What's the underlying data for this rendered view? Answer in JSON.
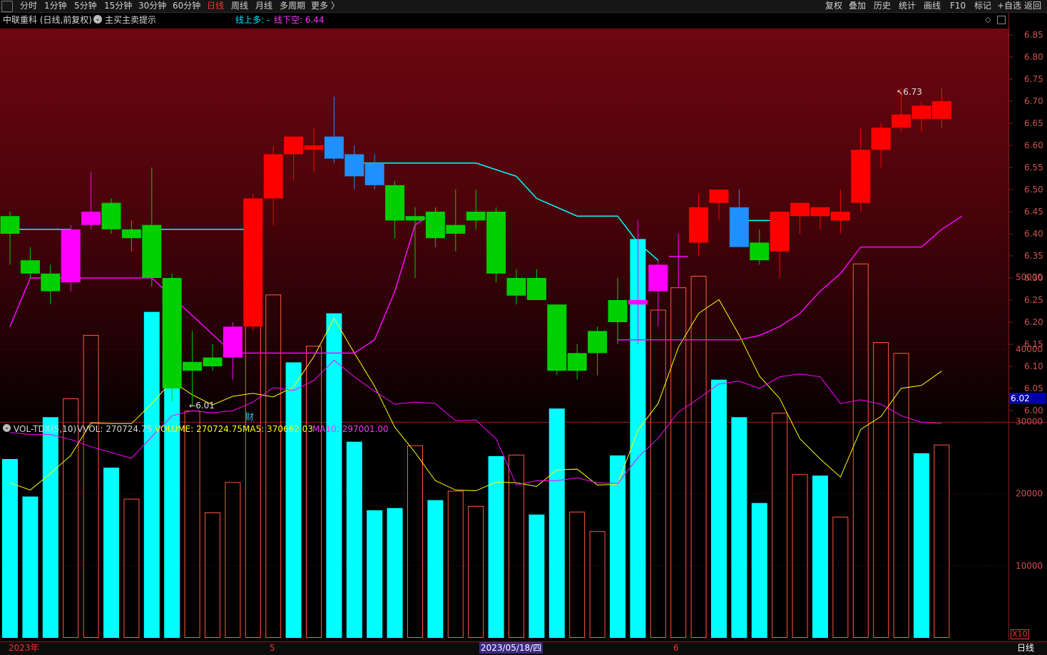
{
  "toolbar": {
    "periods": [
      "分时",
      "1分钟",
      "5分钟",
      "15分钟",
      "30分钟",
      "60分钟",
      "日线",
      "周线",
      "月线",
      "多周期",
      "更多 〉"
    ],
    "active_period": "日线",
    "right_items": [
      "复权",
      "叠加",
      "历史",
      "统计",
      "画线",
      "F10",
      "标记",
      "+自选",
      "返回"
    ]
  },
  "header": {
    "stock_label": "中联重科 (日线,前复权)",
    "indicator_label": "主买主卖提示",
    "line_up_label": "线上多: -",
    "line_down_label": "线下空: 6.44"
  },
  "volume_header": {
    "name": "VOL-TDX(5,10)",
    "vvol": "VVOL: 270724.75",
    "volume": "VOLUME: 270724.75",
    "ma5": "MA5: 370662.03",
    "ma10": "MA10: 297001.00"
  },
  "annotations": {
    "high_label": "6.73",
    "low_label": "6.01",
    "finance_marker": "财",
    "current_price_tag": "6.02"
  },
  "x_axis": {
    "start_label": "2023年",
    "month_may": "5",
    "cursor_date": "2023/05/18/四",
    "month_jun": "6"
  },
  "footer": {
    "period_label": "日线",
    "volume_multiplier": "X10"
  },
  "colors": {
    "background_top": "#6e0610",
    "background_bottom": "#060001",
    "up": "#ff0000",
    "down": "#00d000",
    "magenta": "#ff00ff",
    "cyan": "#00ffff",
    "blue": "#1e90ff",
    "yellow": "#ffff00"
  },
  "chart_data": [
    {
      "type": "candlestick",
      "title": "中联重科 (日线,前复权)",
      "ylim": [
        6.0,
        6.86
      ],
      "y_ticks": [
        "6.85",
        "6.80",
        "6.75",
        "6.70",
        "6.65",
        "6.60",
        "6.55",
        "6.50",
        "6.45",
        "6.40",
        "6.35",
        "6.30",
        "6.25",
        "6.20",
        "6.15",
        "6.10",
        "6.05",
        "6.00"
      ],
      "candles": [
        {
          "o": 6.4,
          "h": 6.45,
          "l": 6.33,
          "c": 6.44,
          "col": "down"
        },
        {
          "o": 6.34,
          "h": 6.37,
          "l": 6.3,
          "c": 6.31,
          "col": "down"
        },
        {
          "o": 6.31,
          "h": 6.33,
          "l": 6.24,
          "c": 6.27,
          "col": "down"
        },
        {
          "o": 6.29,
          "h": 6.42,
          "l": 6.27,
          "c": 6.41,
          "col": "magenta"
        },
        {
          "o": 6.42,
          "h": 6.54,
          "l": 6.41,
          "c": 6.45,
          "col": "magenta"
        },
        {
          "o": 6.47,
          "h": 6.48,
          "l": 6.4,
          "c": 6.41,
          "col": "down"
        },
        {
          "o": 6.41,
          "h": 6.43,
          "l": 6.36,
          "c": 6.39,
          "col": "down"
        },
        {
          "o": 6.42,
          "h": 6.55,
          "l": 6.28,
          "c": 6.3,
          "col": "down"
        },
        {
          "o": 6.3,
          "h": 6.31,
          "l": 6.02,
          "c": 6.05,
          "col": "down"
        },
        {
          "o": 6.11,
          "h": 6.18,
          "l": 6.01,
          "c": 6.09,
          "col": "down"
        },
        {
          "o": 6.12,
          "h": 6.15,
          "l": 6.09,
          "c": 6.1,
          "col": "down"
        },
        {
          "o": 6.12,
          "h": 6.2,
          "l": 6.07,
          "c": 6.19,
          "col": "magenta"
        },
        {
          "o": 6.19,
          "h": 6.49,
          "l": 6.18,
          "c": 6.48,
          "col": "up"
        },
        {
          "o": 6.48,
          "h": 6.6,
          "l": 6.42,
          "c": 6.58,
          "col": "up"
        },
        {
          "o": 6.58,
          "h": 6.62,
          "l": 6.52,
          "c": 6.62,
          "col": "up"
        },
        {
          "o": 6.6,
          "h": 6.64,
          "l": 6.54,
          "c": 6.59,
          "col": "up"
        },
        {
          "o": 6.62,
          "h": 6.71,
          "l": 6.56,
          "c": 6.57,
          "col": "blue"
        },
        {
          "o": 6.58,
          "h": 6.6,
          "l": 6.5,
          "c": 6.53,
          "col": "blue"
        },
        {
          "o": 6.56,
          "h": 6.58,
          "l": 6.5,
          "c": 6.51,
          "col": "blue"
        },
        {
          "o": 6.51,
          "h": 6.52,
          "l": 6.39,
          "c": 6.43,
          "col": "down"
        },
        {
          "o": 6.43,
          "h": 6.46,
          "l": 6.3,
          "c": 6.44,
          "col": "down"
        },
        {
          "o": 6.45,
          "h": 6.46,
          "l": 6.37,
          "c": 6.39,
          "col": "down"
        },
        {
          "o": 6.42,
          "h": 6.5,
          "l": 6.36,
          "c": 6.4,
          "col": "down"
        },
        {
          "o": 6.45,
          "h": 6.5,
          "l": 6.41,
          "c": 6.43,
          "col": "down"
        },
        {
          "o": 6.45,
          "h": 6.46,
          "l": 6.29,
          "c": 6.31,
          "col": "down"
        },
        {
          "o": 6.3,
          "h": 6.32,
          "l": 6.24,
          "c": 6.26,
          "col": "down"
        },
        {
          "o": 6.3,
          "h": 6.32,
          "l": 6.25,
          "c": 6.25,
          "col": "down"
        },
        {
          "o": 6.24,
          "h": 6.24,
          "l": 6.08,
          "c": 6.09,
          "col": "down"
        },
        {
          "o": 6.13,
          "h": 6.15,
          "l": 6.07,
          "c": 6.09,
          "col": "down"
        },
        {
          "o": 6.18,
          "h": 6.19,
          "l": 6.08,
          "c": 6.13,
          "col": "down"
        },
        {
          "o": 6.25,
          "h": 6.3,
          "l": 6.15,
          "c": 6.2,
          "col": "down"
        },
        {
          "o": 6.25,
          "h": 6.43,
          "l": 6.15,
          "c": 6.24,
          "col": "magenta"
        },
        {
          "o": 6.27,
          "h": 6.34,
          "l": 6.19,
          "c": 6.33,
          "col": "magenta"
        },
        {
          "o": 6.35,
          "h": 6.4,
          "l": 6.28,
          "c": 6.35,
          "col": "magenta"
        },
        {
          "o": 6.38,
          "h": 6.49,
          "l": 6.35,
          "c": 6.46,
          "col": "up"
        },
        {
          "o": 6.47,
          "h": 6.5,
          "l": 6.43,
          "c": 6.5,
          "col": "up"
        },
        {
          "o": 6.46,
          "h": 6.5,
          "l": 6.37,
          "c": 6.37,
          "col": "blue"
        },
        {
          "o": 6.38,
          "h": 6.41,
          "l": 6.33,
          "c": 6.34,
          "col": "down"
        },
        {
          "o": 6.36,
          "h": 6.45,
          "l": 6.3,
          "c": 6.45,
          "col": "up"
        },
        {
          "o": 6.44,
          "h": 6.47,
          "l": 6.4,
          "c": 6.47,
          "col": "up"
        },
        {
          "o": 6.44,
          "h": 6.46,
          "l": 6.41,
          "c": 6.46,
          "col": "up"
        },
        {
          "o": 6.43,
          "h": 6.5,
          "l": 6.4,
          "c": 6.45,
          "col": "up"
        },
        {
          "o": 6.47,
          "h": 6.64,
          "l": 6.45,
          "c": 6.59,
          "col": "up"
        },
        {
          "o": 6.59,
          "h": 6.65,
          "l": 6.55,
          "c": 6.64,
          "col": "up"
        },
        {
          "o": 6.64,
          "h": 6.73,
          "l": 6.63,
          "c": 6.67,
          "col": "up"
        },
        {
          "o": 6.66,
          "h": 6.7,
          "l": 6.63,
          "c": 6.69,
          "col": "up"
        },
        {
          "o": 6.66,
          "h": 6.73,
          "l": 6.64,
          "c": 6.7,
          "col": "up"
        }
      ],
      "support_line": [
        [
          0,
          6.19
        ],
        [
          1,
          6.3
        ],
        [
          2,
          6.3
        ],
        [
          3,
          6.3
        ],
        [
          4,
          6.3
        ],
        [
          5,
          6.3
        ],
        [
          6,
          6.3
        ],
        [
          7,
          6.3
        ],
        [
          11,
          6.13
        ],
        [
          17,
          6.13
        ],
        [
          18,
          6.16
        ],
        [
          19,
          6.27
        ],
        [
          20,
          6.42
        ],
        [
          21,
          6.45
        ],
        {
          "break": true
        },
        [
          30,
          6.16
        ],
        [
          35,
          6.16
        ],
        [
          36,
          6.16
        ],
        [
          37,
          6.17
        ],
        [
          38,
          6.19
        ],
        [
          39,
          6.22
        ],
        [
          40,
          6.27
        ],
        [
          41,
          6.31
        ],
        [
          42,
          6.37
        ],
        [
          45,
          6.37
        ],
        [
          46,
          6.41
        ],
        [
          47,
          6.44
        ]
      ],
      "resistance_line": [
        [
          0,
          6.41
        ],
        [
          3,
          6.41
        ],
        {
          "break": true
        },
        [
          7,
          6.41
        ],
        [
          12,
          6.41
        ],
        {
          "break": true
        },
        [
          17,
          6.56
        ],
        [
          23,
          6.56
        ],
        [
          25,
          6.53
        ],
        [
          26,
          6.48
        ],
        [
          28,
          6.44
        ],
        [
          30,
          6.44
        ],
        [
          31,
          6.38
        ],
        [
          32,
          6.34
        ],
        {
          "break": true
        },
        [
          36,
          6.43
        ],
        [
          38,
          6.43
        ]
      ]
    },
    {
      "type": "bar",
      "title": "VOL-TDX(5,10)",
      "ylim": [
        0,
        60000
      ],
      "y_ticks": [
        "50000",
        "40000",
        "30000",
        "20000",
        "10000"
      ],
      "values": [
        24800,
        19600,
        30600,
        33200,
        42000,
        23600,
        19300,
        45200,
        49600,
        31500,
        17400,
        21600,
        49200,
        47600,
        38200,
        40500,
        45000,
        27200,
        17700,
        18000,
        26700,
        19100,
        20400,
        18300,
        25200,
        25400,
        17100,
        31800,
        17500,
        14800,
        25300,
        55300,
        45500,
        48600,
        50200,
        35800,
        30600,
        18700,
        31200,
        22700,
        22500,
        16800,
        51900,
        41000,
        39500,
        25600,
        26800
      ],
      "bar_style": [
        "solid",
        "solid",
        "solid",
        "hollow",
        "hollow",
        "solid",
        "hollow",
        "solid",
        "solid",
        "hollow",
        "hollow",
        "hollow",
        "hollow",
        "hollow",
        "solid",
        "hollow",
        "solid",
        "solid",
        "solid",
        "solid",
        "hollow",
        "solid",
        "hollow",
        "hollow",
        "solid",
        "hollow",
        "solid",
        "solid",
        "hollow",
        "hollow",
        "solid",
        "solid",
        "hollow",
        "hollow",
        "hollow",
        "solid",
        "solid",
        "solid",
        "hollow",
        "hollow",
        "solid",
        "hollow",
        "hollow",
        "hollow",
        "hollow",
        "solid",
        "hollow"
      ],
      "series": [
        {
          "name": "MA5",
          "values": [
            21500,
            20500,
            22800,
            25300,
            29800,
            29700,
            29700,
            32500,
            35600,
            33700,
            32300,
            33500,
            33900,
            33400,
            34800,
            39000,
            44300,
            39500,
            34900,
            29200,
            25700,
            21800,
            20500,
            20400,
            21600,
            21500,
            21000,
            23300,
            23400,
            21200,
            21300,
            28800,
            32500,
            40300,
            45000,
            46900,
            42000,
            36300,
            33200,
            27600,
            24800,
            22300,
            28900,
            30700,
            34600,
            35000,
            37000
          ]
        },
        {
          "name": "MA10",
          "values": [
            28500,
            28200,
            28200,
            27500,
            26500,
            25700,
            24900,
            27900,
            30800,
            31500,
            31200,
            31500,
            32700,
            34700,
            34300,
            35700,
            38500,
            36200,
            34200,
            32400,
            32700,
            32500,
            30100,
            30200,
            27600,
            21200,
            21800,
            21800,
            22200,
            21500,
            21400,
            25000,
            27700,
            31300,
            33200,
            35200,
            35600,
            34600,
            36200,
            36600,
            36200,
            32500,
            33000,
            32400,
            30800,
            29900,
            29700
          ]
        }
      ]
    }
  ]
}
